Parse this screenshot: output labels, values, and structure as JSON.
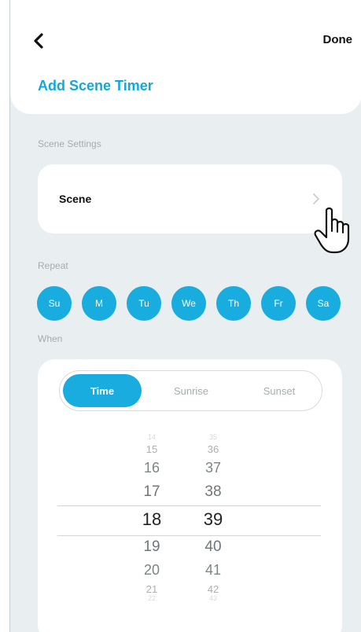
{
  "header": {
    "done_label": "Done",
    "title": "Add Scene Timer"
  },
  "scene_settings": {
    "section_label": "Scene Settings",
    "scene_label": "Scene"
  },
  "repeat": {
    "section_label": "Repeat",
    "days": [
      "Su",
      "M",
      "Tu",
      "We",
      "Th",
      "Fr",
      "Sa"
    ]
  },
  "when": {
    "section_label": "When",
    "tabs": [
      "Time",
      "Sunrise",
      "Sunset"
    ],
    "selected_tab": "Time",
    "hours": [
      "14",
      "15",
      "16",
      "17",
      "18",
      "19",
      "20",
      "21",
      "22"
    ],
    "minutes": [
      "35",
      "36",
      "37",
      "38",
      "39",
      "40",
      "41",
      "42",
      "43"
    ],
    "selected_hour": "18",
    "selected_minute": "39"
  },
  "colors": {
    "accent": "#19acdf",
    "background": "#e9eff0"
  }
}
